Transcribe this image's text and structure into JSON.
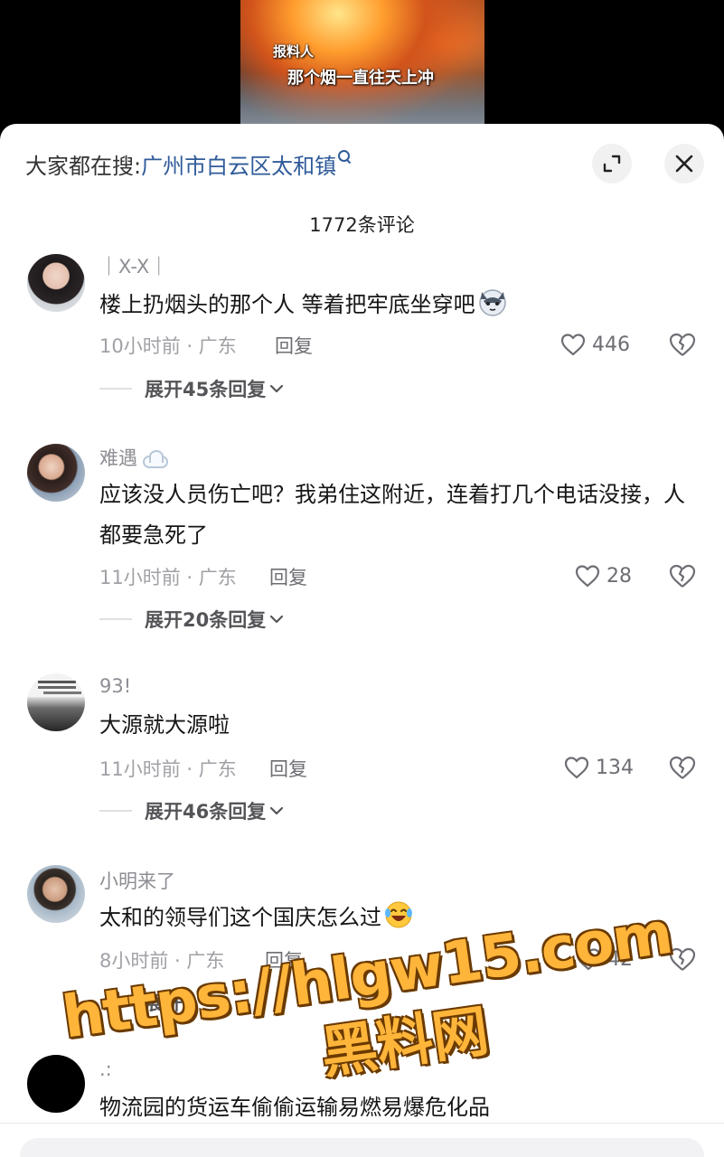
{
  "video": {
    "subtitle_speaker": "报料人",
    "subtitle_line": "那个烟一直往天上冲"
  },
  "header": {
    "search_prefix": "大家都在搜:",
    "search_term": "广州市白云区太和镇",
    "comment_count": "1772条评论"
  },
  "comments": [
    {
      "username": "｜X-X｜",
      "text": "楼上扔烟头的那个人 等着把牢底坐穿吧",
      "time": "10小时前 · 广东",
      "reply": "回复",
      "likes": "446",
      "expand": "展开45条回复"
    },
    {
      "username": "难遇",
      "text": "应该没人员伤亡吧？我弟住这附近，连着打几个电话没接，人都要急死了",
      "time": "11小时前 · 广东",
      "reply": "回复",
      "likes": "28",
      "expand": "展开20条回复"
    },
    {
      "username": "93!",
      "text": "大源就大源啦",
      "time": "11小时前 · 广东",
      "reply": "回复",
      "likes": "134",
      "expand": "展开46条回复"
    },
    {
      "username": "小明来了",
      "text": "太和的领导们这个国庆怎么过",
      "time": "8小时前 · 广东",
      "reply": "回复",
      "likes": "42",
      "expand": "展开"
    },
    {
      "username": ".:",
      "text": "物流园的货运车偷偷运输易燃易爆危化品"
    }
  ],
  "watermark": {
    "url": "https://hlgw15.com",
    "name": "黑料网"
  },
  "colors": {
    "search_term": "#2f5b9a",
    "meta_gray": "#a0a0a6",
    "watermark_orange": "#ffb53a"
  },
  "icons": [
    "expand-icon",
    "close-icon",
    "heart-icon",
    "broken-heart-icon",
    "chevron-down-icon",
    "search-icon",
    "cloud-icon"
  ]
}
